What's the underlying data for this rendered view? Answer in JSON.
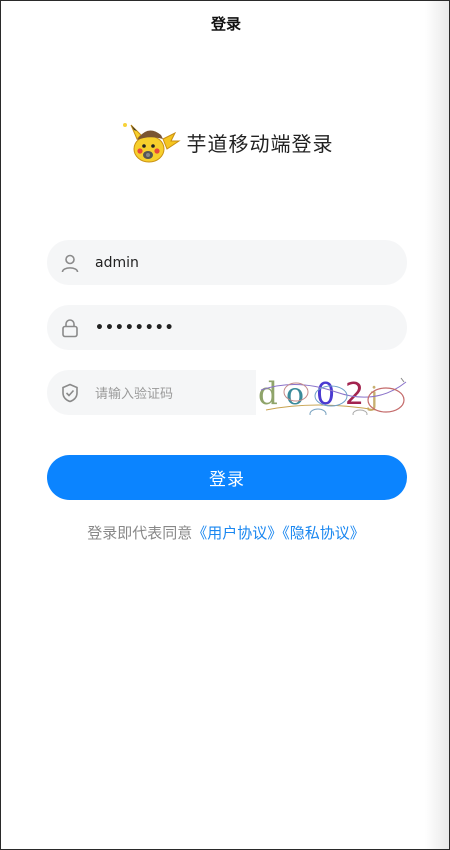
{
  "header": {
    "title": "登录"
  },
  "brand": {
    "title": "芋道移动端登录",
    "logo_icon": "pikachu-mascot-icon"
  },
  "form": {
    "username": {
      "value": "admin",
      "icon": "user-icon"
    },
    "password": {
      "value": "••••••••",
      "icon": "lock-icon"
    },
    "captcha": {
      "placeholder": "请输入验证码",
      "icon": "shield-check-icon",
      "image_text": "do02"
    }
  },
  "login_button": {
    "label": "登录"
  },
  "agreement": {
    "prefix": "登录即代表同意",
    "user_agreement": "《用户协议》",
    "privacy_policy": "《隐私协议》"
  },
  "colors": {
    "primary": "#0b84ff",
    "link": "#1a87f0",
    "input_bg": "#f5f6f7"
  }
}
